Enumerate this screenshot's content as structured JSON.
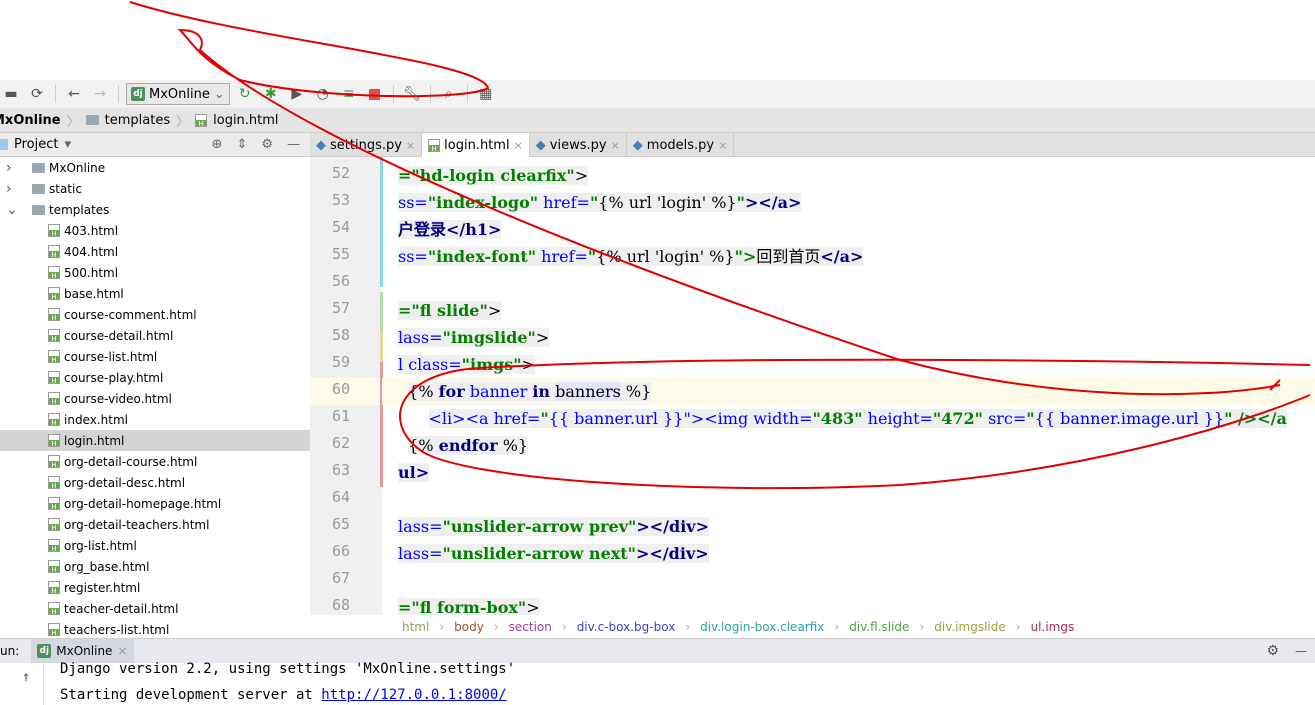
{
  "toolbar": {
    "run_config": "MxOnline",
    "icons": [
      "save-icon",
      "sync-icon",
      "back-icon",
      "forward-icon",
      "rerun-icon",
      "debug-icon",
      "coverage-icon",
      "profile-icon",
      "run-list-icon",
      "stop-icon",
      "wrench-icon",
      "search-icon",
      "structure-icon"
    ]
  },
  "navbar": {
    "project": "MxOnline",
    "folder": "templates",
    "file": "login.html"
  },
  "project_panel": {
    "title": "Project"
  },
  "tree": [
    {
      "label": "MxOnline",
      "type": "folder",
      "depth": 0,
      "expanded": false
    },
    {
      "label": "static",
      "type": "folder",
      "depth": 0,
      "expanded": false
    },
    {
      "label": "templates",
      "type": "folder",
      "depth": 0,
      "expanded": true
    },
    {
      "label": "403.html",
      "type": "file",
      "depth": 1
    },
    {
      "label": "404.html",
      "type": "file",
      "depth": 1
    },
    {
      "label": "500.html",
      "type": "file",
      "depth": 1
    },
    {
      "label": "base.html",
      "type": "file",
      "depth": 1
    },
    {
      "label": "course-comment.html",
      "type": "file",
      "depth": 1
    },
    {
      "label": "course-detail.html",
      "type": "file",
      "depth": 1
    },
    {
      "label": "course-list.html",
      "type": "file",
      "depth": 1
    },
    {
      "label": "course-play.html",
      "type": "file",
      "depth": 1
    },
    {
      "label": "course-video.html",
      "type": "file",
      "depth": 1
    },
    {
      "label": "index.html",
      "type": "file",
      "depth": 1
    },
    {
      "label": "login.html",
      "type": "file",
      "depth": 1,
      "selected": true
    },
    {
      "label": "org-detail-course.html",
      "type": "file",
      "depth": 1
    },
    {
      "label": "org-detail-desc.html",
      "type": "file",
      "depth": 1
    },
    {
      "label": "org-detail-homepage.html",
      "type": "file",
      "depth": 1
    },
    {
      "label": "org-detail-teachers.html",
      "type": "file",
      "depth": 1
    },
    {
      "label": "org-list.html",
      "type": "file",
      "depth": 1
    },
    {
      "label": "org_base.html",
      "type": "file",
      "depth": 1
    },
    {
      "label": "register.html",
      "type": "file",
      "depth": 1
    },
    {
      "label": "teacher-detail.html",
      "type": "file",
      "depth": 1
    },
    {
      "label": "teachers-list.html",
      "type": "file",
      "depth": 1
    }
  ],
  "tabs": [
    {
      "label": "settings.py",
      "type": "py"
    },
    {
      "label": "login.html",
      "type": "html",
      "active": true
    },
    {
      "label": "views.py",
      "type": "py"
    },
    {
      "label": "models.py",
      "type": "py"
    }
  ],
  "code": [
    {
      "n": "52",
      "t": [
        [
          "=\"hd-login clearfix\"",
          "s"
        ],
        [
          ">",
          "p"
        ]
      ]
    },
    {
      "n": "53",
      "t": [
        [
          "ss=",
          "a"
        ],
        [
          "\"index-logo\"",
          "s"
        ],
        [
          " href=",
          "a"
        ],
        [
          "\"",
          "s"
        ],
        [
          "{% url 'login' %}",
          "p"
        ],
        [
          "\"",
          "s"
        ],
        [
          "></a>",
          "t"
        ]
      ]
    },
    {
      "n": "54",
      "t": [
        [
          "户登录</h1>",
          "t"
        ]
      ]
    },
    {
      "n": "55",
      "t": [
        [
          "ss=",
          "a"
        ],
        [
          "\"index-font\"",
          "s"
        ],
        [
          " href=",
          "a"
        ],
        [
          "\"",
          "s"
        ],
        [
          "{% url 'login' %}",
          "p"
        ],
        [
          "\">",
          "s"
        ],
        [
          "回到首页",
          "p"
        ],
        [
          "</a>",
          "t"
        ]
      ]
    },
    {
      "n": "56",
      "t": []
    },
    {
      "n": "57",
      "t": [
        [
          "=\"fl slide\"",
          "s"
        ],
        [
          ">",
          "p"
        ]
      ]
    },
    {
      "n": "58",
      "t": [
        [
          "lass=",
          "a"
        ],
        [
          "\"imgslide\"",
          "s"
        ],
        [
          ">",
          "p"
        ]
      ]
    },
    {
      "n": "59",
      "t": [
        [
          "l class=",
          "a"
        ],
        [
          "\"imgs\"",
          "s"
        ],
        [
          ">",
          "p"
        ]
      ]
    },
    {
      "n": "60",
      "cur": true,
      "t": [
        [
          "  ",
          "n"
        ],
        [
          "{% ",
          "p"
        ],
        [
          "for",
          "k"
        ],
        [
          " banner ",
          "a"
        ],
        [
          "in",
          "k"
        ],
        [
          " ",
          "a"
        ],
        [
          "banners",
          "hl"
        ],
        [
          " %}",
          "p"
        ]
      ]
    },
    {
      "n": "61",
      "t": [
        [
          "      ",
          "n"
        ],
        [
          "<li><a href=",
          "a"
        ],
        [
          "\"",
          "s"
        ],
        [
          "{{ banner.url }}",
          "a"
        ],
        [
          "\"><img width=",
          "a"
        ],
        [
          "\"483\"",
          "s"
        ],
        [
          " height=",
          "a"
        ],
        [
          "\"472\"",
          "s"
        ],
        [
          " src=",
          "a"
        ],
        [
          "\"",
          "s"
        ],
        [
          "{{ banner.image.url }}",
          "a"
        ],
        [
          "\" /></a",
          "s"
        ]
      ]
    },
    {
      "n": "62",
      "t": [
        [
          "  ",
          "n"
        ],
        [
          "{% ",
          "p"
        ],
        [
          "endfor",
          "k"
        ],
        [
          " %}",
          "p"
        ]
      ]
    },
    {
      "n": "63",
      "t": [
        [
          "ul>",
          "t"
        ]
      ]
    },
    {
      "n": "64",
      "t": []
    },
    {
      "n": "65",
      "t": [
        [
          "lass=",
          "a"
        ],
        [
          "\"unslider-arrow prev\"",
          "s"
        ],
        [
          "></div>",
          "t"
        ]
      ]
    },
    {
      "n": "66",
      "t": [
        [
          "lass=",
          "a"
        ],
        [
          "\"unslider-arrow next\"",
          "s"
        ],
        [
          "></div>",
          "t"
        ]
      ]
    },
    {
      "n": "67",
      "t": []
    },
    {
      "n": "68",
      "t": [
        [
          "=\"fl form-box\"",
          "s"
        ],
        [
          ">",
          "p"
        ]
      ]
    }
  ],
  "breadcrumbs": [
    {
      "label": "html",
      "color": "#9a9a60"
    },
    {
      "label": "body",
      "color": "#a0522d"
    },
    {
      "label": "section",
      "color": "#a040a0"
    },
    {
      "label": "div.c-box.bg-box",
      "color": "#4040c0"
    },
    {
      "label": "div.login-box.clearfix",
      "color": "#30a0a0"
    },
    {
      "label": "div.fl.slide",
      "color": "#50a040"
    },
    {
      "label": "div.imgslide",
      "color": "#a0a040"
    },
    {
      "label": "ul.imgs",
      "color": "#a03050"
    }
  ],
  "run": {
    "label": "un:",
    "tab": "MxOnline"
  },
  "console": {
    "line1": "Django version 2.2, using settings 'MxOnline.settings'",
    "line2_prefix": "Starting development server at ",
    "line2_link": "http://127.0.0.1:8000/"
  },
  "colors": {
    "annotation": "#e00000",
    "accent_green": "#4b8f5a"
  }
}
